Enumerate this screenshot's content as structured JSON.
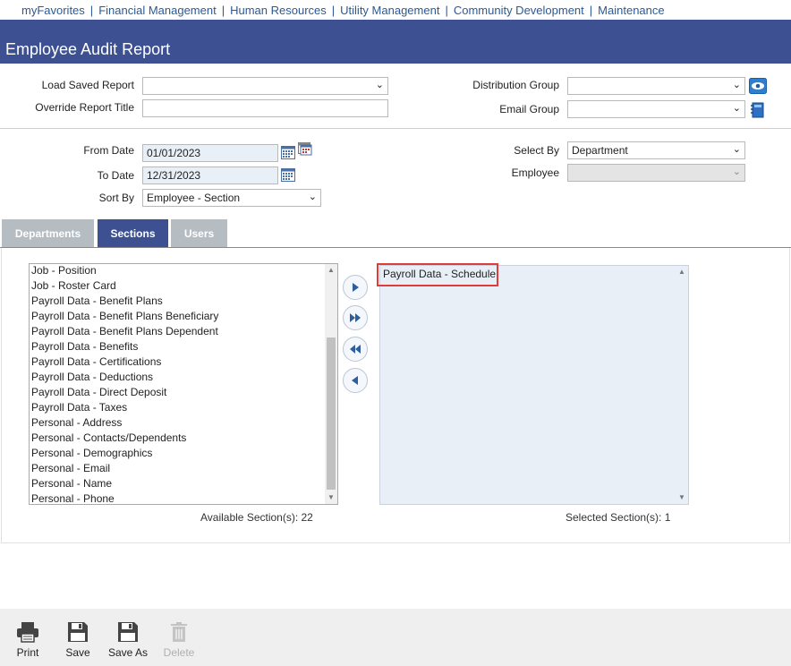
{
  "nav": {
    "items": [
      "myFavorites",
      "Financial Management",
      "Human Resources",
      "Utility Management",
      "Community Development",
      "Maintenance"
    ],
    "separator": "|"
  },
  "page": {
    "title": "Employee Audit Report"
  },
  "form": {
    "load_saved_report_label": "Load Saved Report",
    "load_saved_report_value": "",
    "override_title_label": "Override Report Title",
    "override_title_value": "",
    "distribution_group_label": "Distribution Group",
    "distribution_group_value": "",
    "email_group_label": "Email Group",
    "email_group_value": "",
    "from_date_label": "From Date",
    "from_date_value": "01/01/2023",
    "to_date_label": "To Date",
    "to_date_value": "12/31/2023",
    "sort_by_label": "Sort By",
    "sort_by_value": "Employee - Section",
    "select_by_label": "Select By",
    "select_by_value": "Department",
    "employee_label": "Employee",
    "employee_value": ""
  },
  "tabs": [
    {
      "label": "Departments",
      "active": false
    },
    {
      "label": "Sections",
      "active": true
    },
    {
      "label": "Users",
      "active": false
    }
  ],
  "sections": {
    "available": [
      "Job - Position",
      "Job - Roster Card",
      "Payroll Data - Benefit Plans",
      "Payroll Data - Benefit Plans Beneficiary",
      "Payroll Data - Benefit Plans Dependent",
      "Payroll Data - Benefits",
      "Payroll Data - Certifications",
      "Payroll Data - Deductions",
      "Payroll Data - Direct Deposit",
      "Payroll Data - Taxes",
      "Personal - Address",
      "Personal - Contacts/Dependents",
      "Personal - Demographics",
      "Personal - Email",
      "Personal - Name",
      "Personal - Phone"
    ],
    "selected": [
      "Payroll Data - Schedule"
    ],
    "available_count_text": "Available Section(s): 22",
    "selected_count_text": "Selected Section(s): 1"
  },
  "toolbar": {
    "print_label": "Print",
    "save_label": "Save",
    "save_as_label": "Save As",
    "delete_label": "Delete"
  },
  "colors": {
    "brand": "#3d5192",
    "nav_link": "#2a5a97",
    "tab_inactive": "#b5bcc2",
    "highlight": "#e03c3c"
  }
}
